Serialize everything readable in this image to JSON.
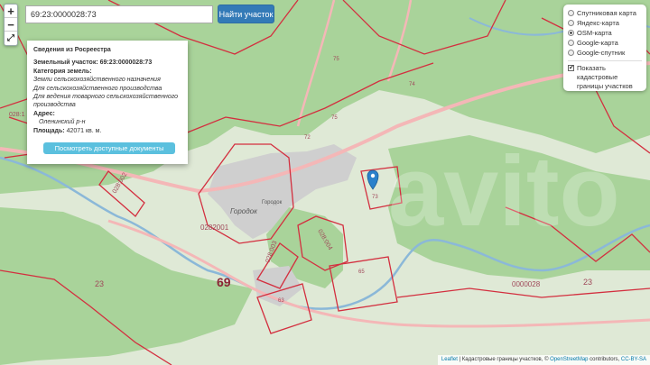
{
  "search": {
    "value": "69:23:0000028:73",
    "button_label": "Найти участок"
  },
  "zoom": {
    "in": "+",
    "out": "−",
    "fullscreen": "⤢"
  },
  "layers": {
    "options": [
      {
        "label": "Спутниковая карта",
        "selected": false
      },
      {
        "label": "Яндекс-карта",
        "selected": false
      },
      {
        "label": "OSM-карта",
        "selected": true
      },
      {
        "label": "Google-карта",
        "selected": false
      },
      {
        "label": "Google-спутник",
        "selected": false
      }
    ],
    "cadastral_checkbox": {
      "label": "Показать кадастровые границы участков",
      "checked": true
    }
  },
  "popup": {
    "title": "Сведения из Росреестра",
    "parcel_label": "Земельный участок:",
    "parcel_value": "69:23:0000028:73",
    "category_label": "Категория земель:",
    "category_value": "Земли сельскохозяйственного назначения",
    "use1": "Для сельскохозяйственного производства",
    "use2": "Для ведения товарного сельскохозяйственного производства",
    "address_label": "Адрес:",
    "address_value": "Оленинский р-н",
    "area_label": "Площадь:",
    "area_value": "42071 кв. м.",
    "button_label": "Посмотреть доступные документы"
  },
  "map": {
    "town_label": "Городок",
    "town_label_small": "Городок",
    "district_number": "69",
    "parcel_labels": [
      "028:002",
      "0282001",
      "028:003",
      "028:004",
      "0000028",
      "23",
      "23",
      "63",
      "65",
      "75",
      "75",
      "72",
      "74",
      "73",
      "028:1"
    ],
    "watermark": "avito"
  },
  "attribution": {
    "leaflet": "Leaflet",
    "text1": " | Кадастровые границы участков, © ",
    "osm": "OpenStreetMap",
    "text2": " contributors, ",
    "license": "CC-BY-SA"
  },
  "colors": {
    "forest": "#a9d39a",
    "meadow": "#dfe9d6",
    "parcel_border": "#d32f3f",
    "road": "#f4b7b7",
    "water": "#8bb8d8",
    "button_primary": "#337ab7",
    "button_info": "#5bc0de"
  }
}
